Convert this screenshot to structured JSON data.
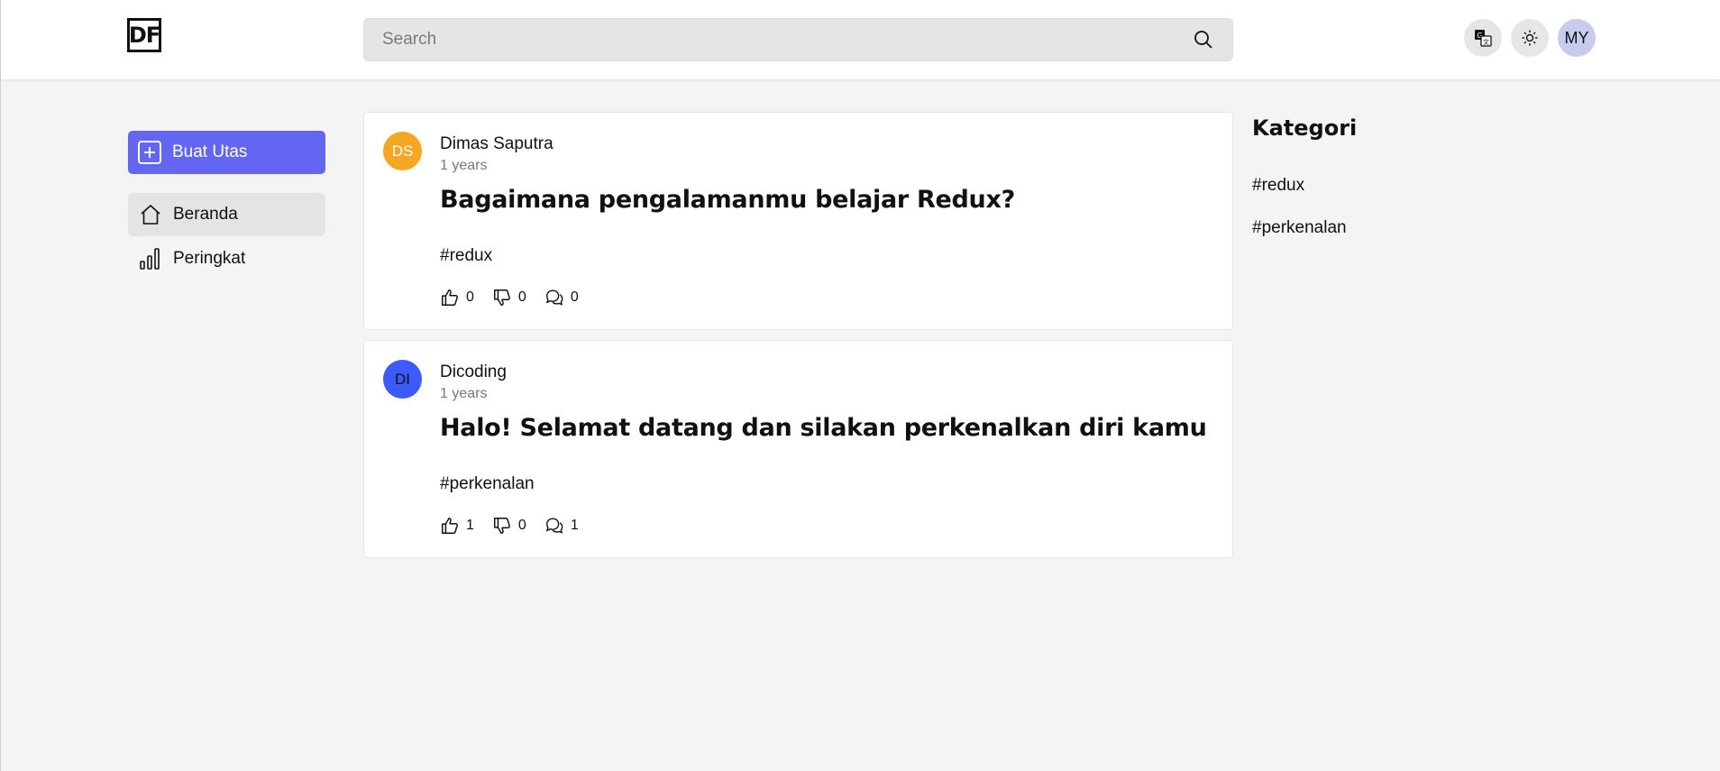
{
  "header": {
    "logo_text": "DF",
    "search_placeholder": "Search",
    "avatar_initials": "MY",
    "avatar_color": "#c7cbee"
  },
  "sidebar": {
    "create_label": "Buat Utas",
    "create_color": "#6366f1",
    "items": [
      {
        "label": "Beranda",
        "icon": "home-icon",
        "active": true
      },
      {
        "label": "Peringkat",
        "icon": "leaderboard-icon",
        "active": false
      }
    ]
  },
  "threads": [
    {
      "initials": "DS",
      "avatar_color": "#f5a623",
      "author": "Dimas Saputra",
      "time": "1 years",
      "title": "Bagaimana pengalamanmu belajar Redux?",
      "tag": "#redux",
      "likes": "0",
      "dislikes": "0",
      "comments": "0"
    },
    {
      "initials": "DI",
      "avatar_color": "#3d5afe",
      "author": "Dicoding",
      "time": "1 years",
      "title": "Halo! Selamat datang dan silakan perkenalkan diri kamu",
      "tag": "#perkenalan",
      "likes": "1",
      "dislikes": "0",
      "comments": "1"
    }
  ],
  "categories": {
    "title": "Kategori",
    "items": [
      "#redux",
      "#perkenalan"
    ]
  }
}
